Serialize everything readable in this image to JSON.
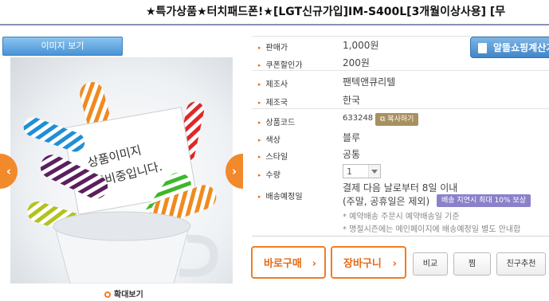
{
  "product_title": "★특가상품★터치패드폰!★[LGT신규가입]IM-S400L[3개월이상사용] [무",
  "image_tab_label": "이미지 보기",
  "image_placeholder_text": "상품이미지 준비중입니다.",
  "zoom_label": "확대보기",
  "calc_button_label": "알뜰쇼핑계산기",
  "copy_button_label": "복사하기",
  "rows": {
    "price": {
      "label": "판매가",
      "value": "1,000원"
    },
    "coupon": {
      "label": "쿠폰할인가",
      "value": "200원"
    },
    "maker": {
      "label": "제조사",
      "value": "팬텍앤큐리텔"
    },
    "country": {
      "label": "제조국",
      "value": "한국"
    },
    "code": {
      "label": "상품코드",
      "value": "633248"
    },
    "color": {
      "label": "색상",
      "value": "블루"
    },
    "style": {
      "label": "스타일",
      "value": "공통"
    },
    "qty": {
      "label": "수량",
      "value": "1"
    },
    "delivery": {
      "label": "배송예정일",
      "value1": "결제 다음 날로부터 8일 이내",
      "value2": "(주말, 공휴일은 제외)"
    }
  },
  "delay_badge": "배송 지연시 최대 10% 보상",
  "notes": [
    "* 예약배송 주문시 예약배송일 기준",
    "* 명절시즌에는 메인페이지에 배송예정일 별도 안내합"
  ],
  "buttons": {
    "buy": "바로구매",
    "cart": "장바구니",
    "compare": "비교",
    "wish": "찜",
    "recommend": "친구추천"
  },
  "colors": {
    "accent_orange": "#ef7d25",
    "blue_button": "#3f85c8",
    "badge_purple": "#8b81c9",
    "copy_badge": "#a89060"
  }
}
